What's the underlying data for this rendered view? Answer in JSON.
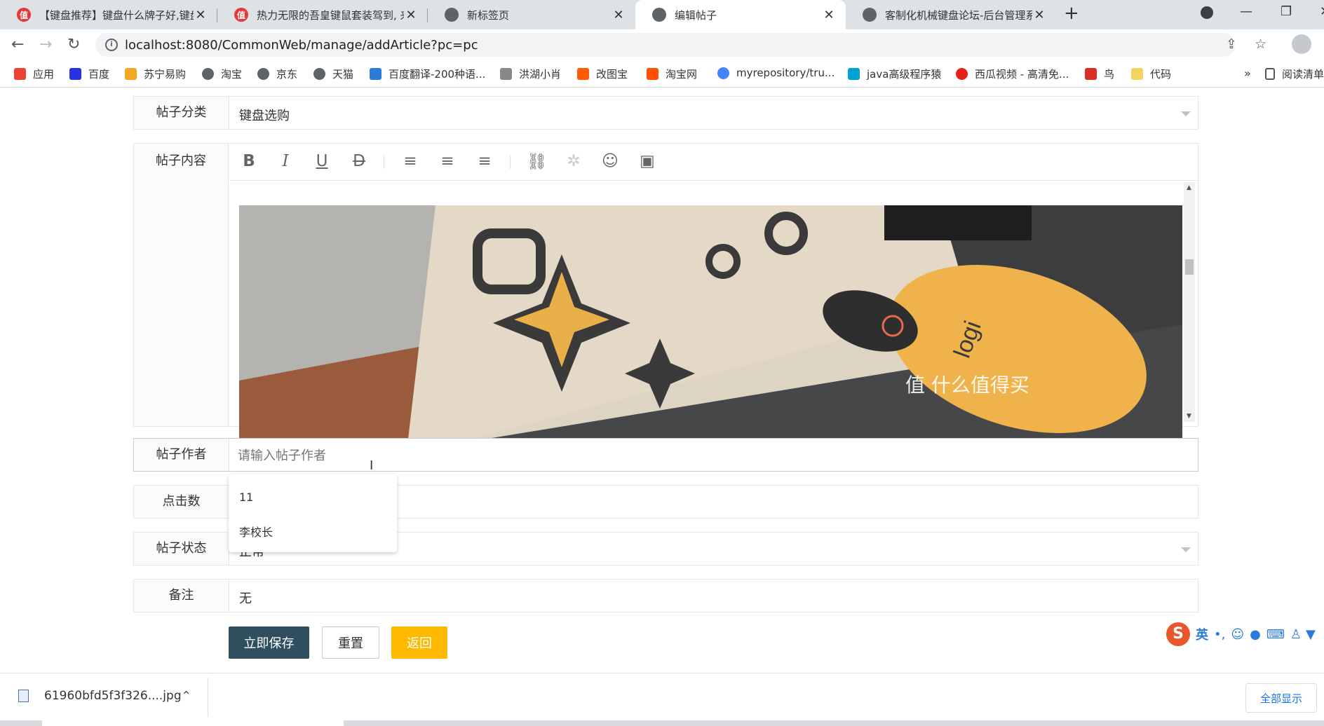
{
  "tabs": [
    {
      "favicon": "值",
      "title": "【键盘推荐】键盘什么牌子好,键盘"
    },
    {
      "favicon": "值",
      "title": "热力无限的吾皇键鼠套装驾到, 来"
    },
    {
      "favicon": "",
      "title": "新标签页"
    },
    {
      "favicon": "",
      "title": "编辑帖子"
    },
    {
      "favicon": "",
      "title": "客制化机械键盘论坛-后台管理系统"
    }
  ],
  "address": {
    "url": "localhost:8080/CommonWeb/manage/addArticle?pc=pc"
  },
  "bookmarks": [
    {
      "label": "应用",
      "color": "#ea4335"
    },
    {
      "label": "百度",
      "color": "#2932e1"
    },
    {
      "label": "苏宁易购",
      "color": "#f5a623"
    },
    {
      "label": "淘宝",
      "color": "#5f6368"
    },
    {
      "label": "京东",
      "color": "#5f6368"
    },
    {
      "label": "天猫",
      "color": "#5f6368"
    },
    {
      "label": "百度翻译-200种语...",
      "color": "#2b7bd9"
    },
    {
      "label": "洪湖小肖",
      "color": "#888888"
    },
    {
      "label": "改图宝",
      "color": "#ff5a00"
    },
    {
      "label": "淘宝网",
      "color": "#ff5000"
    },
    {
      "label": "myrepository/tru...",
      "color": "#4285f4"
    },
    {
      "label": "java高级程序猿",
      "color": "#00a1d6"
    },
    {
      "label": "西瓜视频 - 高清免...",
      "color": "#e62117"
    },
    {
      "label": "鸟",
      "color": "#d93025"
    },
    {
      "label": "代码",
      "color": "#f4d35e"
    }
  ],
  "bookmarks_more": "»",
  "reading_list": "阅读清单",
  "form": {
    "category_label": "帖子分类",
    "category_value": "键盘选购",
    "content_label": "帖子内容",
    "image_watermark": "值 什么值得买",
    "author_label": "帖子作者",
    "author_placeholder": "请输入帖子作者",
    "author_suggestions": [
      "11",
      "李校长"
    ],
    "clicks_label": "点击数",
    "status_label": "帖子状态",
    "status_value": "正常",
    "remark_label": "备注",
    "remark_value": "无"
  },
  "buttons": {
    "save": "立即保存",
    "reset": "重置",
    "back": "返回"
  },
  "download": {
    "filename": "61960bfd5f3f326....jpg",
    "show_all": "全部显示"
  },
  "ime": {
    "lang": "英"
  }
}
